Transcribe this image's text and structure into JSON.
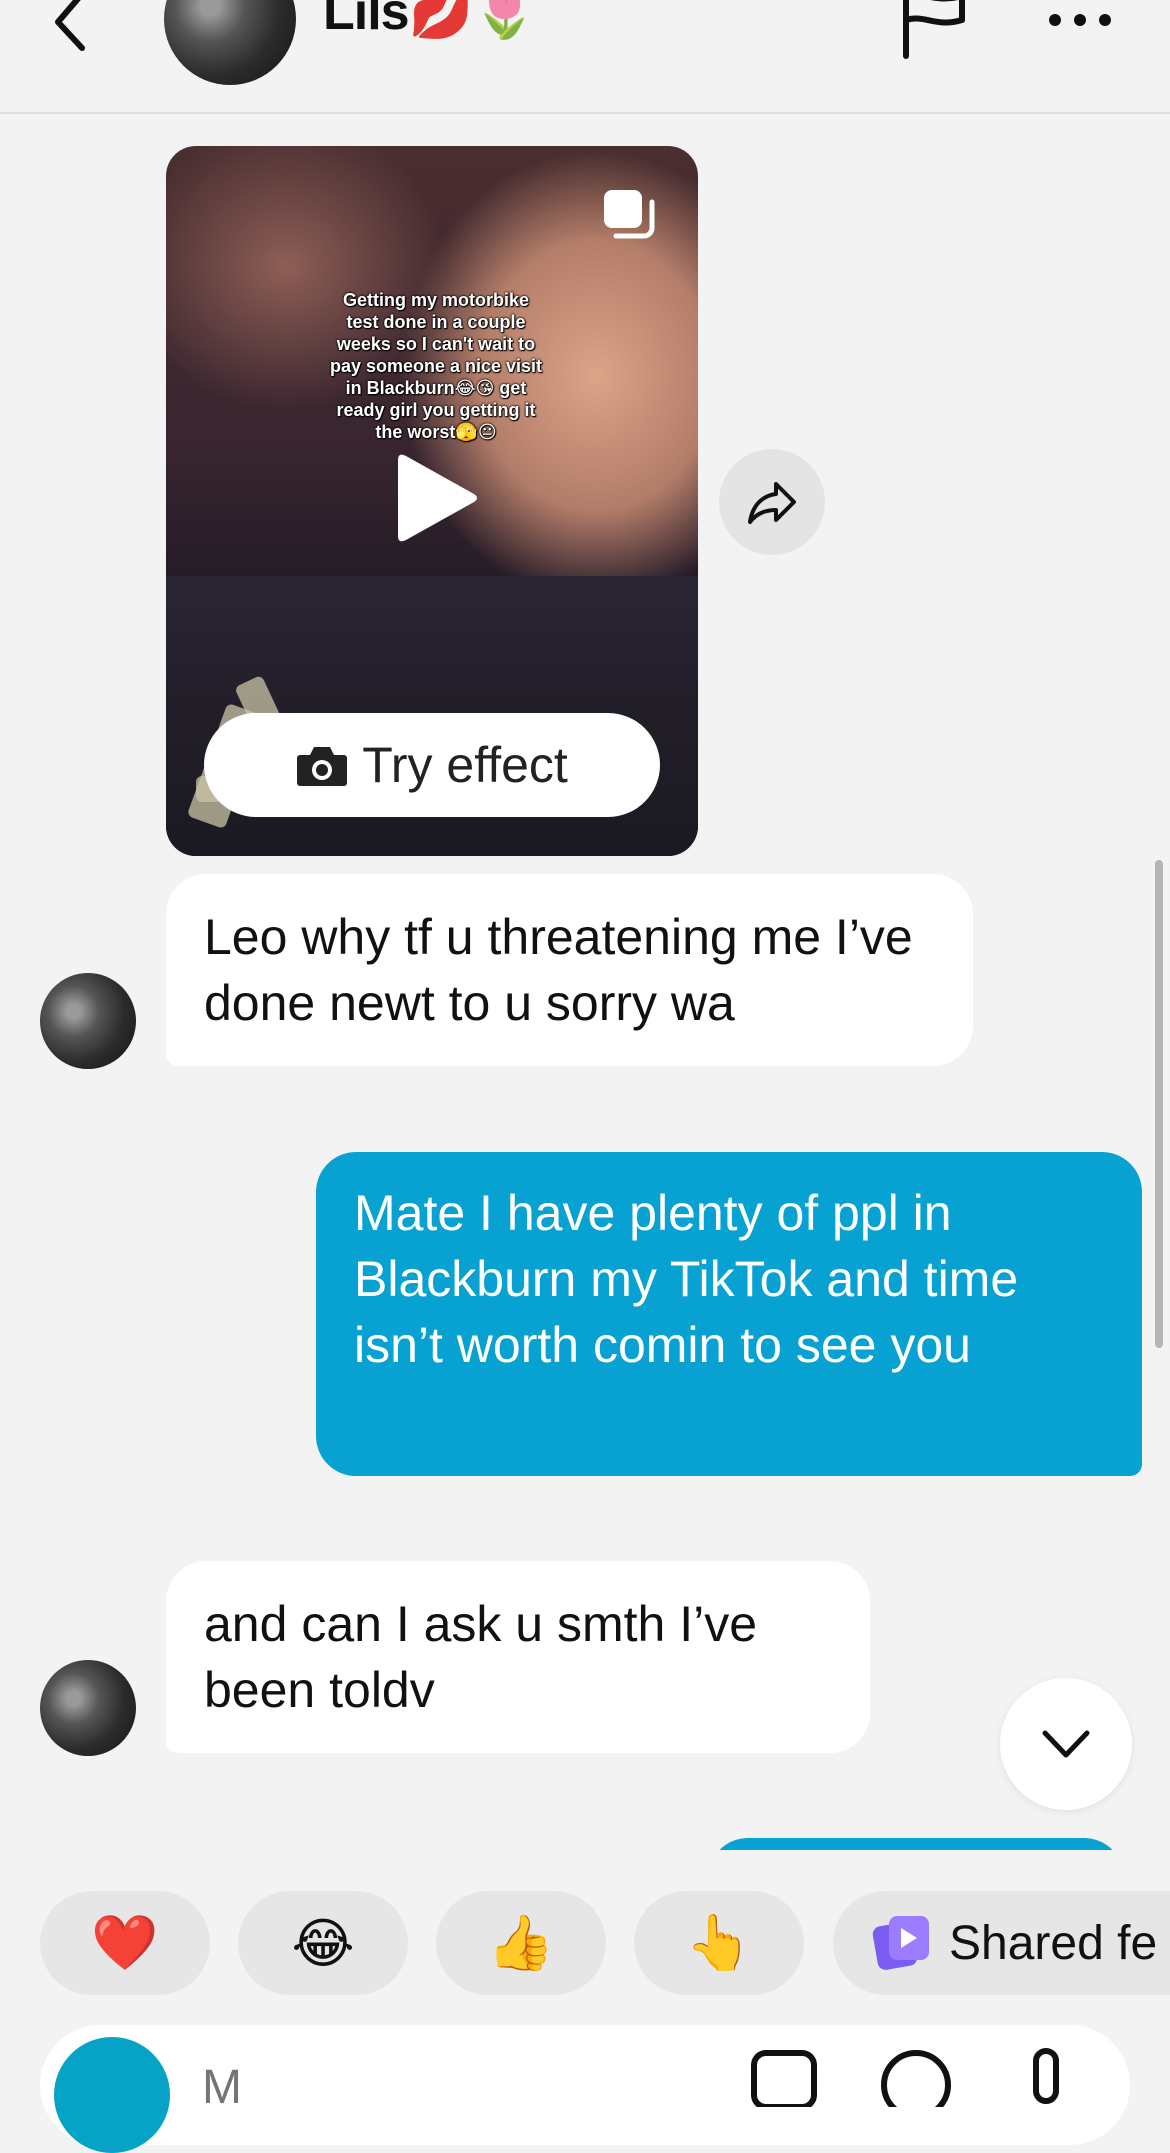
{
  "header": {
    "name": "Lils💋🌷"
  },
  "media_post": {
    "overlay_text": "Getting my motorbike test done in a couple weeks so I can't wait to pay someone a nice visit in Blackburn😂😘 get ready girl you getting it the worst🫣😐",
    "try_effect_label": "Try effect"
  },
  "messages": [
    {
      "direction": "incoming",
      "text": "Leo why tf u threatening me I’ve done newt to u sorry wa"
    },
    {
      "direction": "outgoing",
      "text": "Mate I have plenty of ppl in Blackburn my TikTok and time isn’t worth comin to see you"
    },
    {
      "direction": "incoming",
      "text": "and can I ask u smth I’ve been toldv"
    }
  ],
  "reactions": [
    "❤️",
    "😂",
    "👍",
    "👆"
  ],
  "shared_chip": {
    "label": "Shared fe"
  },
  "composer": {
    "placeholder": "M"
  },
  "colors": {
    "outgoing_bubble": "#07a1d2",
    "incoming_bubble": "#ffffff",
    "background": "#f3f3f3",
    "camera_button": "#06a3c6",
    "shared_icon": "#7b5cf0"
  },
  "icons": {
    "back": "chevron-left-icon",
    "flag": "flag-icon",
    "more": "more-horizontal-icon",
    "copy": "copy-icon",
    "play": "play-icon",
    "camera": "camera-icon",
    "share": "share-icon",
    "scroll_down": "chevron-down-icon"
  }
}
